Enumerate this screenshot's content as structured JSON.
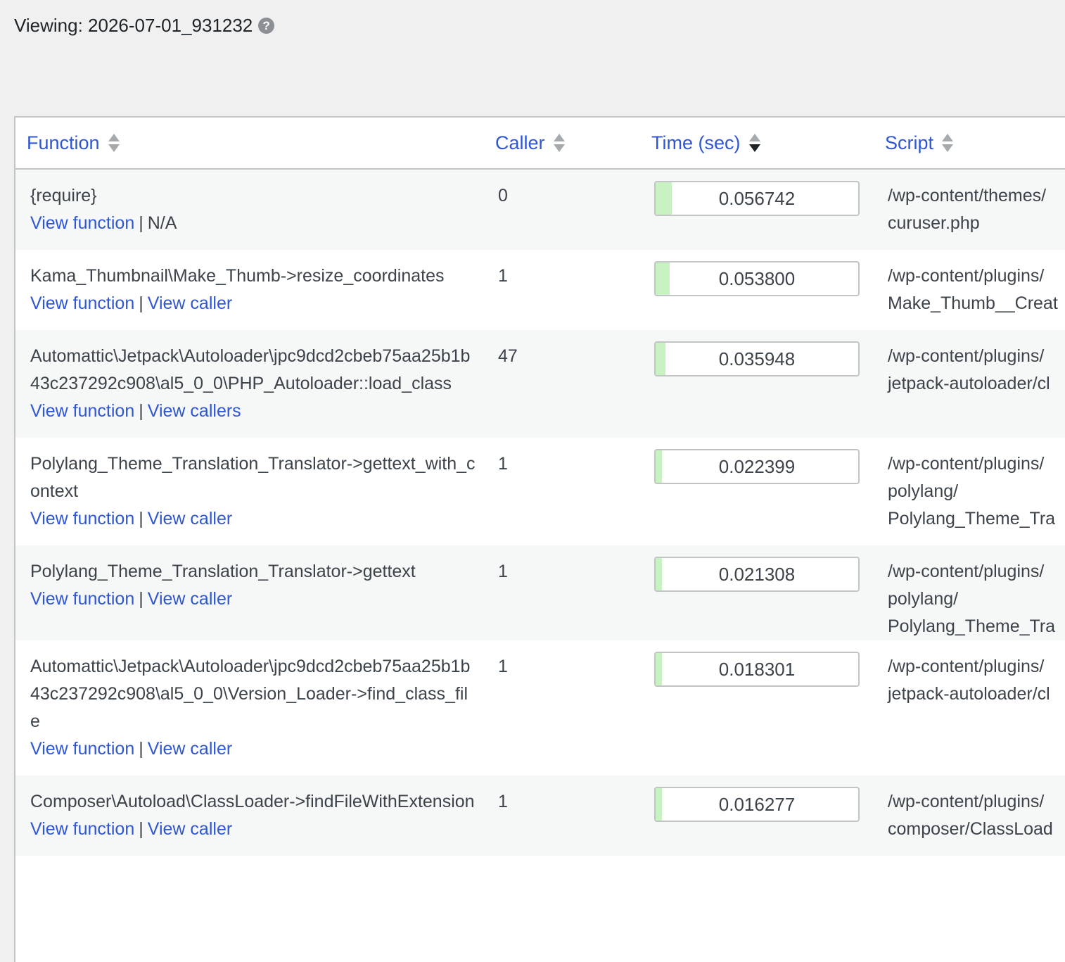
{
  "viewing": {
    "label": "Viewing: 2026-07-01_931232",
    "help_icon": "question-circle-icon"
  },
  "columns": {
    "function": "Function",
    "caller": "Caller",
    "time": "Time (sec)",
    "script": "Script"
  },
  "link_labels": {
    "view_function": "View function",
    "separator": "|"
  },
  "accent_color": "#2f56d3",
  "bar_color": "#c9f2c2",
  "rows": [
    {
      "function": "{require}",
      "secondary_link": "N/A",
      "secondary_is_link": false,
      "caller": "0",
      "time": "0.056742",
      "time_fraction": 0.08,
      "script_lines": [
        "/wp-content/themes/",
        "curuser.php"
      ]
    },
    {
      "function": "Kama_Thumbnail\\Make_Thumb->resize_coordinates",
      "secondary_link": "View caller",
      "secondary_is_link": true,
      "caller": "1",
      "time": "0.053800",
      "time_fraction": 0.07,
      "script_lines": [
        "/wp-content/plugins/",
        "Make_Thumb__Creat"
      ]
    },
    {
      "function": "Automattic\\Jetpack\\Autoloader\\jpc9dcd2cbeb75aa25b1b43c237292c908\\al5_0_0\\PHP_Autoloader::load_class",
      "secondary_link": "View callers",
      "secondary_is_link": true,
      "caller": "47",
      "time": "0.035948",
      "time_fraction": 0.05,
      "script_lines": [
        "/wp-content/plugins/",
        "jetpack-autoloader/cl"
      ]
    },
    {
      "function": "Polylang_Theme_Translation_Translator->gettext_with_context",
      "secondary_link": "View caller",
      "secondary_is_link": true,
      "caller": "1",
      "time": "0.022399",
      "time_fraction": 0.03,
      "script_lines": [
        "/wp-content/plugins/",
        "polylang/",
        "Polylang_Theme_Tra"
      ]
    },
    {
      "function": "Polylang_Theme_Translation_Translator->gettext",
      "secondary_link": "View caller",
      "secondary_is_link": true,
      "caller": "1",
      "time": "0.021308",
      "time_fraction": 0.03,
      "script_lines": [
        "/wp-content/plugins/",
        "polylang/",
        "Polylang_Theme_Tra"
      ]
    },
    {
      "function": "Automattic\\Jetpack\\Autoloader\\jpc9dcd2cbeb75aa25b1b43c237292c908\\al5_0_0\\Version_Loader->find_class_file",
      "secondary_link": "View caller",
      "secondary_is_link": true,
      "caller": "1",
      "time": "0.018301",
      "time_fraction": 0.03,
      "script_lines": [
        "/wp-content/plugins/",
        "jetpack-autoloader/cl"
      ]
    },
    {
      "function": "Composer\\Autoload\\ClassLoader->findFileWithExtension",
      "secondary_link": "View caller",
      "secondary_is_link": true,
      "caller": "1",
      "time": "0.016277",
      "time_fraction": 0.03,
      "script_lines": [
        "/wp-content/plugins/",
        "composer/ClassLoad"
      ]
    }
  ]
}
